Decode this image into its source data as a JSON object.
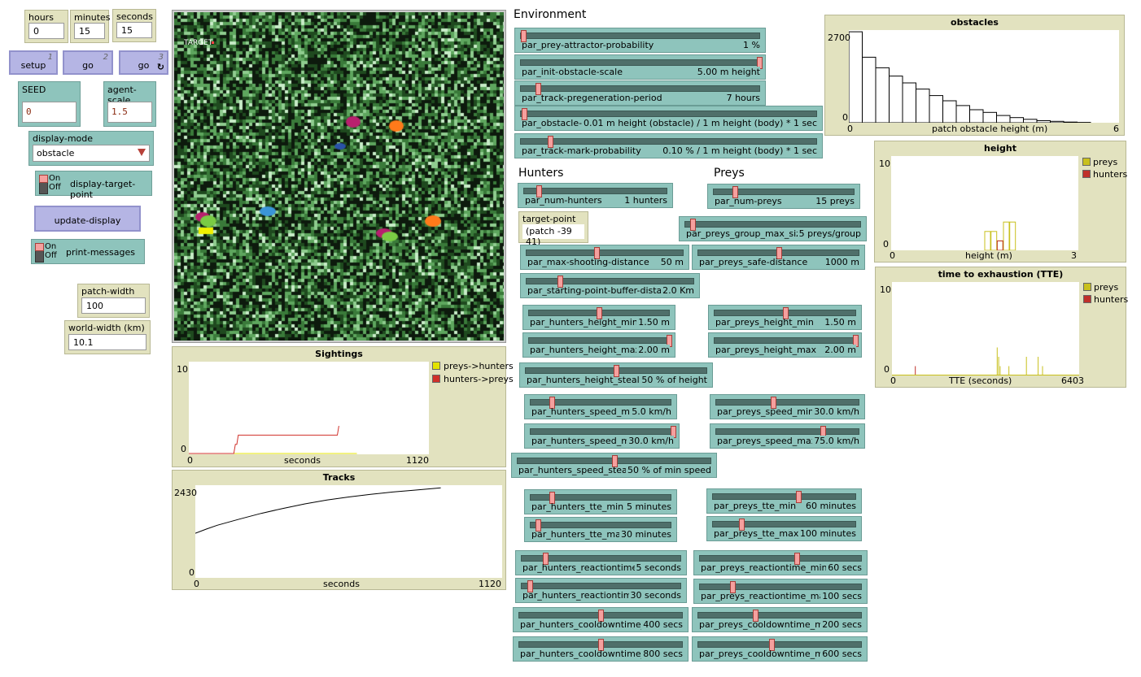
{
  "monitors": {
    "hours": {
      "label": "hours",
      "value": "0"
    },
    "minutes": {
      "label": "minutes",
      "value": "15"
    },
    "seconds": {
      "label": "seconds",
      "value": "15"
    }
  },
  "buttons": {
    "setup": {
      "label": "setup",
      "key": "1"
    },
    "go_once": {
      "label": "go",
      "key": "2"
    },
    "go_forever": {
      "label": "go",
      "key": "3",
      "loop_icon": "forever-icon"
    },
    "update_display": {
      "label": "update-display"
    }
  },
  "inputs": {
    "seed": {
      "label": "SEED",
      "value": "0"
    },
    "agent_scale": {
      "label": "agent-scale",
      "value": "1.5"
    }
  },
  "chooser": {
    "label": "display-mode",
    "value": "obstacle"
  },
  "switches": {
    "display_target_point": {
      "on": "On",
      "off": "Off",
      "label": "display-target-point"
    },
    "print_messages": {
      "on": "On",
      "off": "Off",
      "label": "print-messages"
    }
  },
  "patch_width": {
    "label": "patch-width (m)",
    "value": "100"
  },
  "world_width": {
    "label": "world-width (km)",
    "value": "10.1"
  },
  "world_view": {
    "target_label": "TARGET"
  },
  "sections": {
    "environment": "Environment",
    "hunters": "Hunters",
    "preys": "Preys"
  },
  "target_point": {
    "label": "target-point",
    "value": "(patch -39 41)"
  },
  "sliders": [
    {
      "id": "prey-attractor-probability",
      "name": "par_prey-attractor-probability",
      "value": "1 %",
      "pos": 0.01
    },
    {
      "id": "init-obstacle-scale",
      "name": "par_init-obstacle-scale",
      "value": "5.00 m height",
      "pos": 1.0
    },
    {
      "id": "track-pregeneration-period",
      "name": "par_track-pregeneration-period",
      "value": "7 hours",
      "pos": 0.07
    },
    {
      "id": "obstacle-damage",
      "name": "par_obstacle-damage",
      "value": "0.01 m height (obstacle) / 1 m height (body) * 1 sec",
      "pos": 0.01
    },
    {
      "id": "track-mark-probability",
      "name": "par_track-mark-probability",
      "value": "0.10 % / 1 m height (body) * 1 sec",
      "pos": 0.1
    },
    {
      "id": "num-hunters",
      "name": "par_num-hunters",
      "value": "1 hunters",
      "pos": 0.1
    },
    {
      "id": "num-preys",
      "name": "par_num-preys",
      "value": "15 preys",
      "pos": 0.15
    },
    {
      "id": "preys-group-max-size",
      "name": "par_preys_group_max_size",
      "value": "5 preys/group",
      "pos": 0.04
    },
    {
      "id": "max-shooting-distance",
      "name": "par_max-shooting-distance",
      "value": "50 m",
      "pos": 0.45
    },
    {
      "id": "preys-safe-distance",
      "name": "par_preys_safe-distance",
      "value": "1000 m",
      "pos": 0.5
    },
    {
      "id": "starting-point-buffer-distance",
      "name": "par_starting-point-buffer-distance",
      "value": "2.0 Km",
      "pos": 0.2
    },
    {
      "id": "hunters-height-min",
      "name": "par_hunters_height_min",
      "value": "1.50 m",
      "pos": 0.5
    },
    {
      "id": "preys-height-min",
      "name": "par_preys_height_min",
      "value": "1.50 m",
      "pos": 0.5
    },
    {
      "id": "hunters-height-max",
      "name": "par_hunters_height_max",
      "value": "2.00 m",
      "pos": 1.0
    },
    {
      "id": "preys-height-max",
      "name": "par_preys_height_max",
      "value": "2.00 m",
      "pos": 1.0
    },
    {
      "id": "hunters-height-stealth",
      "name": "par_hunters_height_stealth",
      "value": "50 % of height",
      "pos": 0.5
    },
    {
      "id": "hunters-speed-min",
      "name": "par_hunters_speed_min",
      "value": "5.0 km/h",
      "pos": 0.15
    },
    {
      "id": "preys-speed-min",
      "name": "par_preys_speed_min",
      "value": "30.0 km/h",
      "pos": 0.4
    },
    {
      "id": "hunters-speed-max",
      "name": "par_hunters_speed_max",
      "value": "30.0 km/h",
      "pos": 1.0
    },
    {
      "id": "preys-speed-max",
      "name": "par_preys_speed_max",
      "value": "75.0 km/h",
      "pos": 0.75
    },
    {
      "id": "hunters-speed-stealth",
      "name": "par_hunters_speed_stealth",
      "value": "50 % of min speed",
      "pos": 0.5
    },
    {
      "id": "hunters-tte-min",
      "name": "par_hunters_tte_min",
      "value": "5 minutes",
      "pos": 0.15
    },
    {
      "id": "preys-tte-min",
      "name": "par_preys_tte_min",
      "value": "60 minutes",
      "pos": 0.6
    },
    {
      "id": "hunters-tte-max",
      "name": "par_hunters_tte_max",
      "value": "30 minutes",
      "pos": 0.05
    },
    {
      "id": "preys-tte-max",
      "name": "par_preys_tte_max",
      "value": "100 minutes",
      "pos": 0.2
    },
    {
      "id": "hunters-reactiontime-min",
      "name": "par_hunters_reactiontime_min",
      "value": "5 seconds",
      "pos": 0.15
    },
    {
      "id": "preys-reactiontime-min",
      "name": "par_preys_reactiontime_min",
      "value": "60 secs",
      "pos": 0.6
    },
    {
      "id": "hunters-reactiontime-max",
      "name": "par_hunters_reactiontime...",
      "value": "30 seconds",
      "pos": 0.05
    },
    {
      "id": "preys-reactiontime-max",
      "name": "par_preys_reactiontime_max",
      "value": "100 secs",
      "pos": 0.2
    },
    {
      "id": "hunters-cooldowntime-min",
      "name": "par_hunters_cooldowntime_min",
      "value": "400 secs",
      "pos": 0.5
    },
    {
      "id": "preys-cooldowntime-min",
      "name": "par_preys_cooldowntime_min",
      "value": "200 secs",
      "pos": 0.35
    },
    {
      "id": "hunters-cooldowntime-max",
      "name": "par_hunters_cooldowntime_max",
      "value": "800 secs",
      "pos": 0.5
    },
    {
      "id": "preys-cooldowntime-max",
      "name": "par_preys_cooldowntime_max",
      "value": "600 secs",
      "pos": 0.45
    }
  ],
  "plots": {
    "sightings": {
      "title": "Sightings",
      "ymax": "10",
      "ymin": "0",
      "xmin": "0",
      "xmax": "1120",
      "xlabel": "seconds",
      "legend": [
        {
          "name": "preys->hunters",
          "color": "#e4e400"
        },
        {
          "name": "hunters->preys",
          "color": "#d0302a"
        }
      ]
    },
    "tracks": {
      "title": "Tracks",
      "ymax": "2430",
      "ymin": "0",
      "xmin": "0",
      "xmax": "1120",
      "xlabel": "seconds"
    },
    "obstacles": {
      "title": "obstacles",
      "ymax": "2700",
      "ymin": "0",
      "xmin": "0",
      "xmax": "6",
      "xlabel": "patch obstacle height (m)"
    },
    "height": {
      "title": "height",
      "ymax": "10",
      "ymin": "0",
      "xmin": "0",
      "xmax": "3",
      "xlabel": "height (m)",
      "legend": [
        {
          "name": "preys",
          "color": "#c8c01c"
        },
        {
          "name": "hunters",
          "color": "#c0302a"
        }
      ]
    },
    "tte": {
      "title": "time to exhaustion (TTE)",
      "ymax": "10",
      "ymin": "0",
      "xmin": "0",
      "xmax": "6403",
      "xlabel": "TTE (seconds)",
      "legend": [
        {
          "name": "preys",
          "color": "#c8c01c"
        },
        {
          "name": "hunters",
          "color": "#c0302a"
        }
      ]
    }
  },
  "chart_data": [
    {
      "type": "line",
      "title": "Sightings",
      "xlabel": "seconds",
      "ylabel": "",
      "xlim": [
        0,
        1120
      ],
      "ylim": [
        0,
        10
      ],
      "series": [
        {
          "name": "preys->hunters",
          "color": "#e4e400",
          "x": [
            0,
            1120
          ],
          "y": [
            0,
            0
          ]
        },
        {
          "name": "hunters->preys",
          "color": "#d0302a",
          "x": [
            0,
            300,
            310,
            320,
            330,
            990,
            1000
          ],
          "y": [
            0,
            0,
            1,
            1,
            2,
            2,
            3
          ]
        }
      ]
    },
    {
      "type": "line",
      "title": "Tracks",
      "xlabel": "seconds",
      "ylabel": "",
      "xlim": [
        0,
        1120
      ],
      "ylim": [
        0,
        2430
      ],
      "series": [
        {
          "name": "",
          "color": "#000000",
          "x": [
            0,
            50,
            100,
            200,
            300,
            400,
            500,
            600,
            700,
            800,
            900,
            1000,
            1100,
            1120
          ],
          "y": [
            1170,
            1280,
            1380,
            1540,
            1690,
            1820,
            1940,
            2040,
            2120,
            2190,
            2250,
            2300,
            2350,
            2360
          ]
        }
      ]
    },
    {
      "type": "bar",
      "title": "obstacles",
      "xlabel": "patch obstacle height (m)",
      "ylabel": "",
      "xlim": [
        0,
        6
      ],
      "ylim": [
        0,
        2700
      ],
      "categories": [
        "0",
        "0.3",
        "0.6",
        "0.9",
        "1.2",
        "1.5",
        "1.8",
        "2.1",
        "2.4",
        "2.7",
        "3.0",
        "3.3",
        "3.6",
        "3.9",
        "4.2",
        "4.5",
        "4.8",
        "5.1"
      ],
      "values": [
        2650,
        1910,
        1600,
        1360,
        1160,
        980,
        790,
        640,
        500,
        380,
        300,
        210,
        150,
        100,
        60,
        40,
        20,
        10
      ]
    },
    {
      "type": "bar",
      "title": "height",
      "xlabel": "height (m)",
      "ylabel": "",
      "xlim": [
        0,
        3
      ],
      "ylim": [
        0,
        10
      ],
      "series": [
        {
          "name": "preys",
          "color": "#c8c01c",
          "x": [
            1.5,
            1.6,
            1.7,
            1.8,
            1.9
          ],
          "values": [
            2,
            2,
            1,
            3,
            3
          ]
        },
        {
          "name": "hunters",
          "color": "#c0302a",
          "x": [
            1.7
          ],
          "values": [
            1
          ]
        }
      ]
    },
    {
      "type": "bar",
      "title": "time to exhaustion (TTE)",
      "xlabel": "TTE (seconds)",
      "ylabel": "",
      "xlim": [
        0,
        6403
      ],
      "ylim": [
        0,
        10
      ],
      "series": [
        {
          "name": "preys",
          "color": "#c8c01c",
          "x": [
            3600,
            3650,
            3700,
            4000,
            4600,
            5000,
            5150
          ],
          "values": [
            3,
            2,
            1,
            1,
            2,
            2,
            1
          ]
        },
        {
          "name": "hunters",
          "color": "#c0302a",
          "x": [
            800
          ],
          "values": [
            1
          ]
        }
      ]
    }
  ]
}
